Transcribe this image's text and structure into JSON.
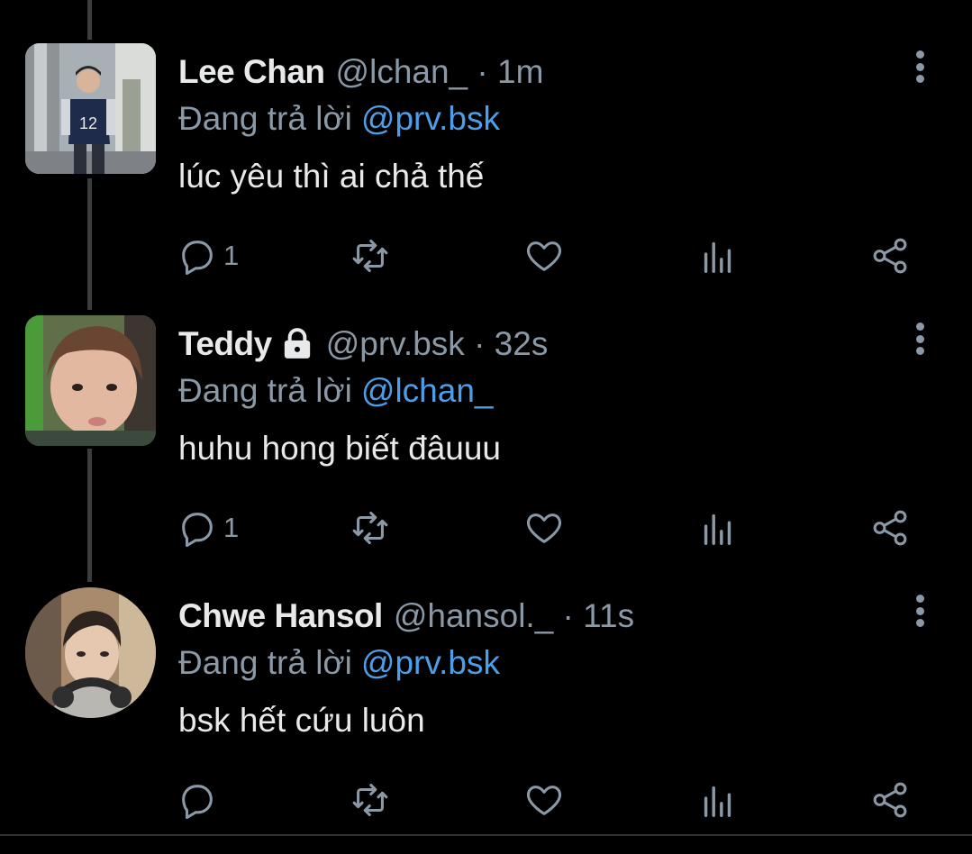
{
  "colors": {
    "background": "#000000",
    "primary_text": "#e7e9ea",
    "secondary_text": "#8b98a5",
    "mention": "#4d9ee8",
    "thread_line": "#3a3d40"
  },
  "tweets": [
    {
      "name": "Lee Chan",
      "handle": "@lchan_ · 1m",
      "locked": false,
      "reply_label": "Đang trả lời",
      "reply_to": "@prv.bsk",
      "text": "lúc yêu thì ai chả thế",
      "reply_count": "1",
      "avatar_shape": "rounded-square"
    },
    {
      "name": "Teddy",
      "handle": "@prv.bsk · 32s",
      "locked": true,
      "reply_label": "Đang trả lời",
      "reply_to": "@lchan_",
      "text": "huhu hong biết đâuuu",
      "reply_count": "1",
      "avatar_shape": "rounded-square"
    },
    {
      "name": "Chwe Hansol",
      "handle": "@hansol._ · 11s",
      "locked": false,
      "reply_label": "Đang trả lời",
      "reply_to": "@prv.bsk",
      "text": "bsk hết cứu luôn",
      "reply_count": "",
      "avatar_shape": "circle"
    }
  ],
  "icons": {
    "reply": "reply-icon",
    "retweet": "retweet-icon",
    "like": "heart-icon",
    "views": "views-icon",
    "share": "share-icon",
    "more": "more-vertical-icon",
    "lock": "lock-icon"
  }
}
